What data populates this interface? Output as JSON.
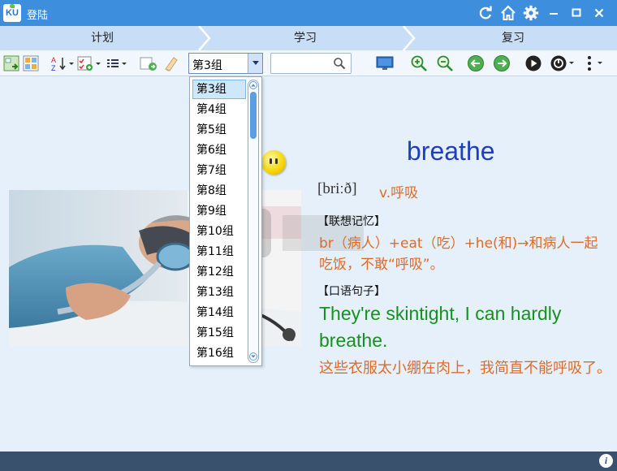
{
  "app": {
    "logo_text": "KU",
    "title": "登陆",
    "title_icons": [
      "refresh-icon",
      "home-icon",
      "gear-icon",
      "minimize-icon",
      "maximize-icon",
      "close-icon"
    ],
    "colors": {
      "titlebar": "#3d8fdd",
      "stepbar": "#c8def6",
      "statusbar": "#3a516e",
      "background": "#e6f0fb"
    }
  },
  "steps": [
    {
      "label": "计划"
    },
    {
      "label": "学习"
    },
    {
      "label": "复习"
    }
  ],
  "toolbar": {
    "group_select": {
      "value": "第3组",
      "options": [
        "第3组",
        "第4组",
        "第5组",
        "第6组",
        "第7组",
        "第8组",
        "第9组",
        "第10组",
        "第11组",
        "第12组",
        "第13组",
        "第14组",
        "第15组",
        "第16组"
      ]
    },
    "search": {
      "value": "",
      "placeholder": ""
    },
    "icons": [
      "import-icon",
      "grid-view-icon",
      "sort-az-icon",
      "checklist-add-icon",
      "list-view-icon",
      "export-icon",
      "eraser-icon",
      "monitor-icon",
      "zoom-in-icon",
      "zoom-out-icon",
      "previous-icon",
      "next-icon",
      "play-icon",
      "timer-icon",
      "more-icon"
    ]
  },
  "card": {
    "word": "breathe",
    "phonetic": "[briːð]",
    "pos_meaning": "v.呼吸",
    "mnemonic_label": "【联想记忆】",
    "mnemonic_text": "br（病人）+eat（吃）+he(和)→和病人一起吃饭，不敢“呼吸”。",
    "sentence_label": "【口语句子】",
    "sentence_en": "They're skintight, I can hardly breathe.",
    "sentence_zh": "这些衣服太小绷在肉上，我简直不能呼吸了。",
    "colors": {
      "word": "#1f3dbf",
      "orange": "#dd6b2a",
      "green": "#14911e"
    }
  },
  "status": {
    "info_label": "i"
  }
}
